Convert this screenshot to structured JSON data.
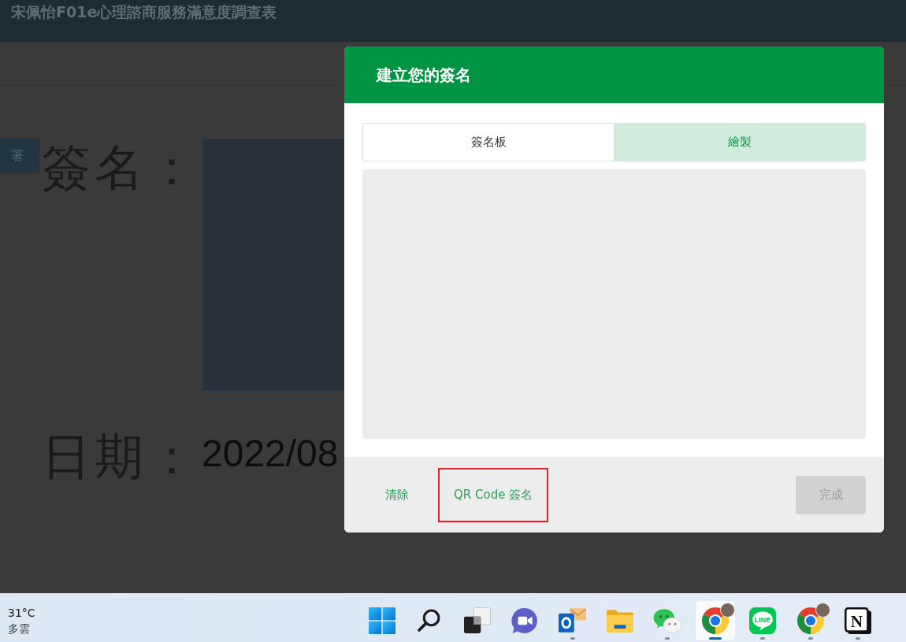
{
  "page": {
    "title": "宋佩怡F01e心理諮商服務滿意度調查表",
    "tag": "署",
    "signature_label": "簽名：",
    "date_label": "日期：",
    "date_value": "2022/08"
  },
  "dialog": {
    "title": "建立您的簽名",
    "tabs": [
      {
        "label": "簽名板",
        "selected": false
      },
      {
        "label": "繪製",
        "selected": true
      }
    ],
    "buttons": [
      {
        "label": "清除",
        "kind": "action",
        "highlighted": false,
        "disabled": false
      },
      {
        "label": "QR Code 簽名",
        "kind": "link",
        "highlighted": true,
        "disabled": false
      },
      {
        "label": "完成",
        "kind": "primary",
        "highlighted": false,
        "disabled": true
      }
    ]
  },
  "taskbar": {
    "weather": {
      "temperature": "31°C",
      "condition": "多雲"
    },
    "apps": [
      {
        "kind": "start",
        "running": false,
        "selected": false,
        "badge": false
      },
      {
        "kind": "search",
        "running": false,
        "selected": false,
        "badge": false
      },
      {
        "kind": "taskview",
        "running": false,
        "selected": false,
        "badge": false
      },
      {
        "kind": "meet",
        "running": false,
        "selected": false,
        "badge": false
      },
      {
        "kind": "mail",
        "running": true,
        "selected": false,
        "badge": false
      },
      {
        "kind": "files",
        "running": false,
        "selected": false,
        "badge": false
      },
      {
        "kind": "wechat",
        "running": true,
        "selected": false,
        "badge": false
      },
      {
        "kind": "chrome",
        "running": true,
        "selected": true,
        "badge": true
      },
      {
        "kind": "line",
        "glyph": "LINE",
        "running": true,
        "selected": false,
        "badge": false
      },
      {
        "kind": "chrome",
        "running": true,
        "selected": false,
        "badge": true
      },
      {
        "kind": "notion",
        "glyph": "N",
        "running": true,
        "selected": false,
        "badge": false
      }
    ]
  }
}
